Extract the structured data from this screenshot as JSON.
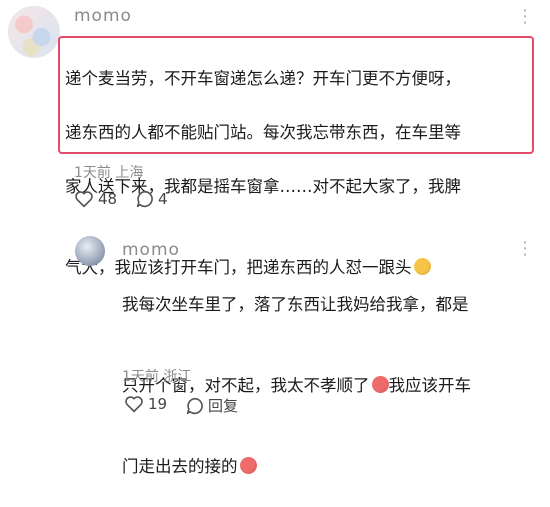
{
  "main_comment": {
    "username": "momo",
    "text_lines": [
      "递个麦当劳，不开车窗递怎么递？开车门更不方便呀，",
      "递东西的人都不能贴门站。每次我忘带东西，在车里等",
      "家人送下来，我都是摇车窗拿……对不起大家了，我脾",
      "气大，我应该打开车门，把递东西的人怼一跟头"
    ],
    "time": "1天前",
    "location": "上海",
    "likes": "48",
    "comments": "4"
  },
  "reply": {
    "username": "momo",
    "text_lines": [
      "我每次坐车里了，落了东西让我妈给我拿，都是",
      "只开个窗，对不起，我太不孝顺了",
      "门走出去的接的"
    ],
    "text_line2_tail": "我应该开车",
    "time": "1天前",
    "location": "浙江",
    "likes": "19",
    "reply_label": "回复"
  },
  "icons": {
    "more": "more-icon",
    "like": "heart-icon",
    "comment": "comment-icon",
    "emoji": "emoji-icon"
  }
}
